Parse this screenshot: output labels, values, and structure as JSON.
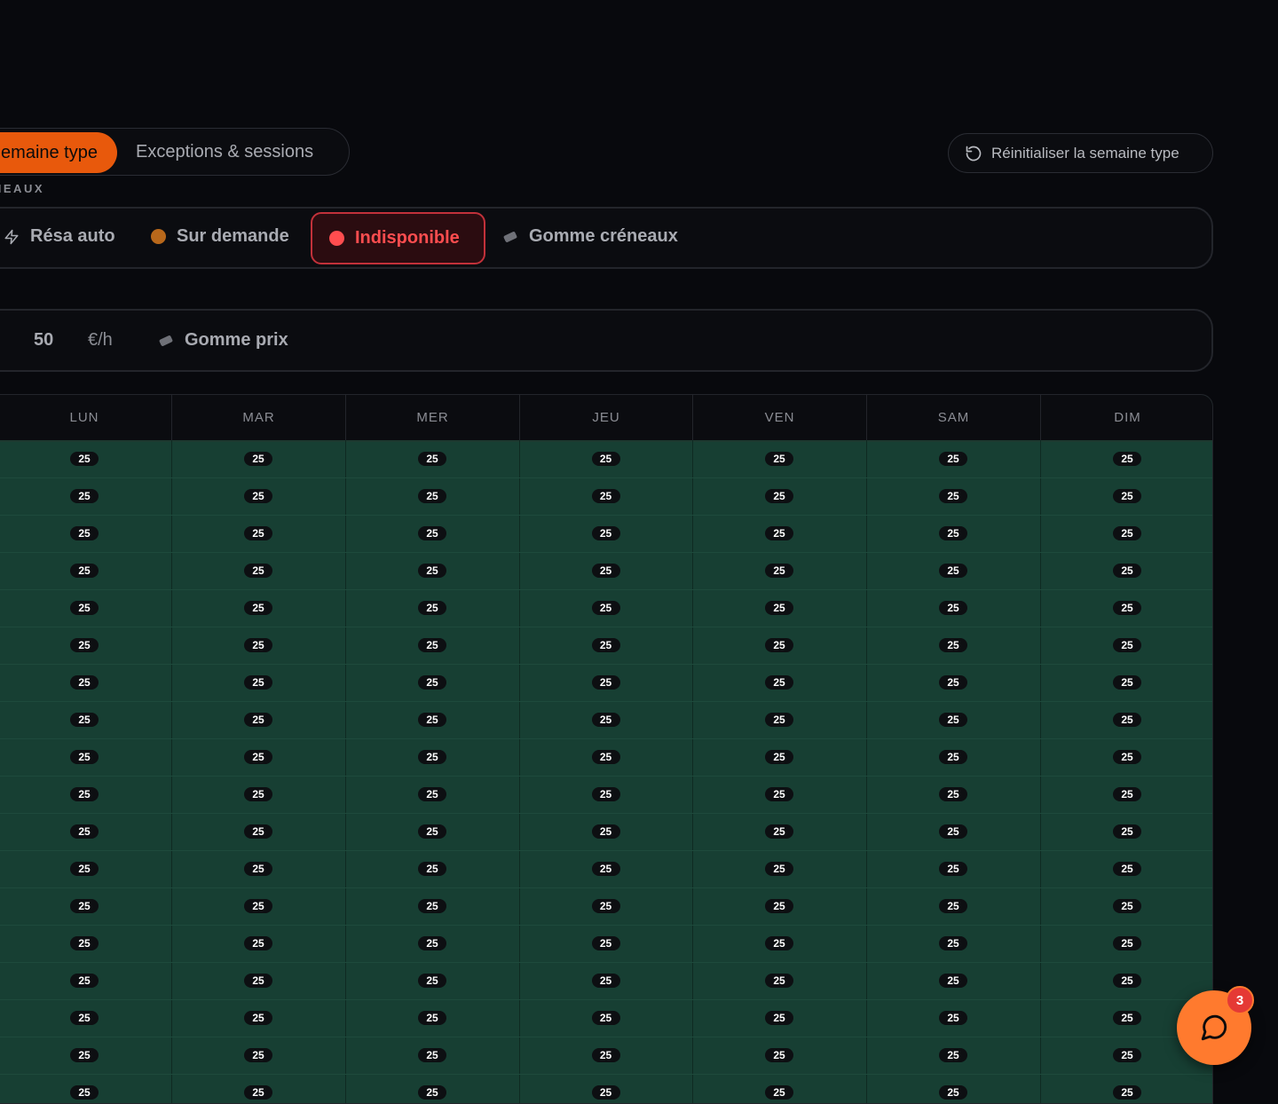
{
  "mode_tabs": {
    "active_label": "emaine type",
    "second_label": "Exceptions & sessions"
  },
  "section_label": "NEAUX",
  "reset_button": {
    "label": "Réinitialiser la semaine type",
    "icon": "rotate-ccw-icon"
  },
  "legend": {
    "items": [
      {
        "label": "Résa auto",
        "icon": "bolt-icon"
      },
      {
        "label": "Sur demande",
        "color": "#b8681b"
      },
      {
        "label": "Indisponible",
        "color": "#ff4d4f",
        "active": true
      },
      {
        "label": "Gomme créneaux",
        "icon": "eraser-icon"
      }
    ]
  },
  "price_bar": {
    "value": "50",
    "unit": "€/h",
    "eraser_label": "Gomme prix"
  },
  "grid": {
    "days": [
      "LUN",
      "MAR",
      "MER",
      "JEU",
      "VEN",
      "SAM",
      "DIM"
    ],
    "cell_value": "25",
    "rows": 18,
    "cell_color": "#173f33"
  },
  "chat": {
    "badge_count": "3",
    "icon": "chat-bubble-icon"
  }
}
